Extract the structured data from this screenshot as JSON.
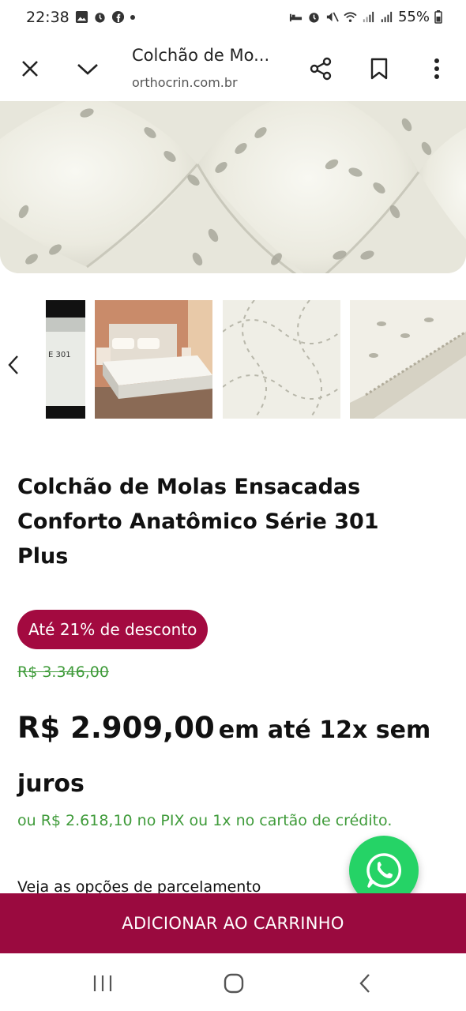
{
  "status_bar": {
    "time": "22:38",
    "battery": "55%",
    "icons_left": [
      "image-icon",
      "alarm-icon",
      "facebook-icon",
      "dot-icon"
    ],
    "icons_right": [
      "bed-icon",
      "alarm-icon",
      "mute-icon",
      "wifi-icon",
      "signal-icon",
      "signal-icon",
      "battery-icon"
    ]
  },
  "toolbar": {
    "title": "Colchão de Mo...",
    "url": "orthocrin.com.br",
    "icons": [
      "close-icon",
      "chevron-down-icon",
      "share-icon",
      "bookmark-icon",
      "more-vert-icon"
    ]
  },
  "gallery": {
    "thumbnails": [
      "mattress-label-thumbnail",
      "bedroom-bed-thumbnail",
      "quilted-surface-thumbnail",
      "mattress-edge-thumbnail"
    ],
    "partial_thumb_text": "E 301"
  },
  "product": {
    "title_line1": "Colchão de Molas Ensacadas",
    "title_line2": "Conforto Anatômico Série 301",
    "title_line3": "Plus",
    "discount_badge": "Até 21% de desconto",
    "old_price": "R$ 3.346,00",
    "price": "R$ 2.909,00",
    "installments": "em até 12x sem juros",
    "pix_text": "ou R$ 2.618,10 no PIX ou 1x no cartão de crédito.",
    "installment_options": "Veja as opções de parcelamento"
  },
  "cart": {
    "button_label": "ADICIONAR AO CARRINHO"
  },
  "colors": {
    "brand": "#9a0a3f",
    "badge": "#a30a40",
    "green_text": "#3f9b3a",
    "whatsapp": "#25d366"
  }
}
